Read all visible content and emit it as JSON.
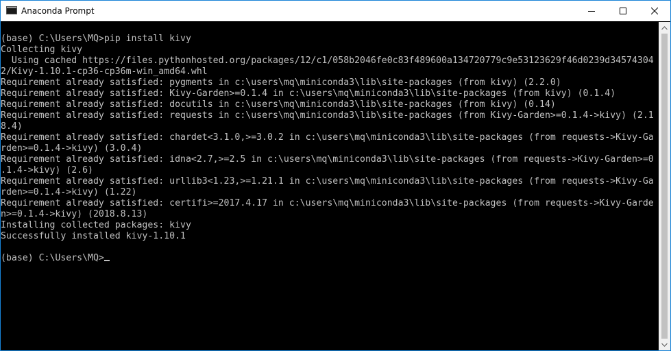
{
  "window": {
    "title": "Anaconda Prompt"
  },
  "icons": {
    "app": "console-icon",
    "minimize": "minimize-icon",
    "maximize": "maximize-icon",
    "close": "close-icon",
    "scroll_up": "arrow-up-icon",
    "scroll_down": "arrow-down-icon"
  },
  "console": {
    "lines": [
      "(base) C:\\Users\\MQ>pip install kivy",
      "Collecting kivy",
      "  Using cached https://files.pythonhosted.org/packages/12/c1/058b2046fe0c83f489600a134720779c9e53123629f46d0239d34574304",
      "2/Kivy-1.10.1-cp36-cp36m-win_amd64.whl",
      "Requirement already satisfied: pygments in c:\\users\\mq\\miniconda3\\lib\\site-packages (from kivy) (2.2.0)",
      "Requirement already satisfied: Kivy-Garden>=0.1.4 in c:\\users\\mq\\miniconda3\\lib\\site-packages (from kivy) (0.1.4)",
      "Requirement already satisfied: docutils in c:\\users\\mq\\miniconda3\\lib\\site-packages (from kivy) (0.14)",
      "Requirement already satisfied: requests in c:\\users\\mq\\miniconda3\\lib\\site-packages (from Kivy-Garden>=0.1.4->kivy) (2.1",
      "8.4)",
      "Requirement already satisfied: chardet<3.1.0,>=3.0.2 in c:\\users\\mq\\miniconda3\\lib\\site-packages (from requests->Kivy-Ga",
      "rden>=0.1.4->kivy) (3.0.4)",
      "Requirement already satisfied: idna<2.7,>=2.5 in c:\\users\\mq\\miniconda3\\lib\\site-packages (from requests->Kivy-Garden>=0",
      ".1.4->kivy) (2.6)",
      "Requirement already satisfied: urllib3<1.23,>=1.21.1 in c:\\users\\mq\\miniconda3\\lib\\site-packages (from requests->Kivy-Ga",
      "rden>=0.1.4->kivy) (1.22)",
      "Requirement already satisfied: certifi>=2017.4.17 in c:\\users\\mq\\miniconda3\\lib\\site-packages (from requests->Kivy-Garde",
      "n>=0.1.4->kivy) (2018.8.13)",
      "Installing collected packages: kivy",
      "Successfully installed kivy-1.10.1",
      ""
    ],
    "prompt": "(base) C:\\Users\\MQ>"
  },
  "colors": {
    "console_bg": "#000000",
    "console_fg": "#c0c0c0",
    "window_border": "#1883d7",
    "titlebar_bg": "#ffffff"
  }
}
